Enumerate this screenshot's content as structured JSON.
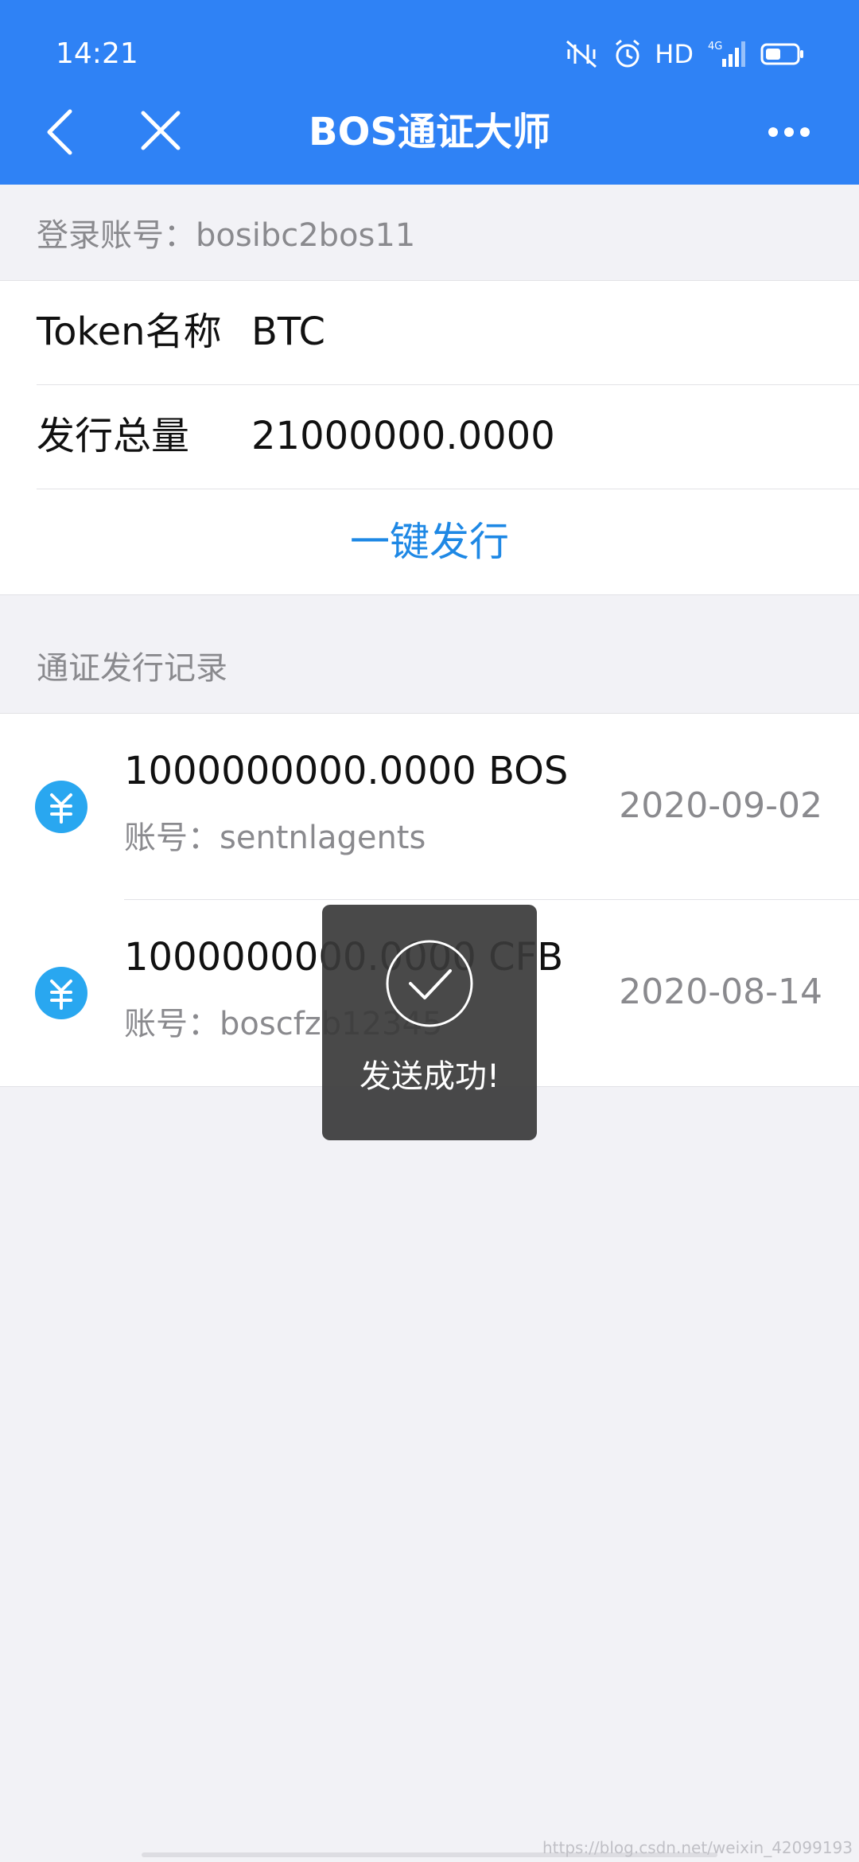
{
  "status_bar": {
    "time": "14:21",
    "network": "HD"
  },
  "nav": {
    "title": "BOS通证大师"
  },
  "account": {
    "login_text": "登录账号：bosibc2bos11"
  },
  "form": {
    "token_label": "Token名称",
    "token_value": "BTC",
    "supply_label": "发行总量",
    "supply_value": "21000000.0000",
    "issue_button": "一键发行"
  },
  "records": {
    "section_title": "通证发行记录",
    "items": [
      {
        "amount": "1000000000.0000 BOS",
        "account": "账号：sentnlagents",
        "date": "2020-09-02"
      },
      {
        "amount": "1000000000.0000 CFB",
        "account": "账号：boscfzb12345",
        "date": "2020-08-14"
      }
    ]
  },
  "toast": {
    "message": "发送成功!"
  },
  "watermark": "https://blog.csdn.net/weixin_42099193",
  "colors": {
    "header": "#2f82f5",
    "link": "#1e88e5",
    "coin_icon": "#29a7f0",
    "background": "#f2f2f6"
  }
}
